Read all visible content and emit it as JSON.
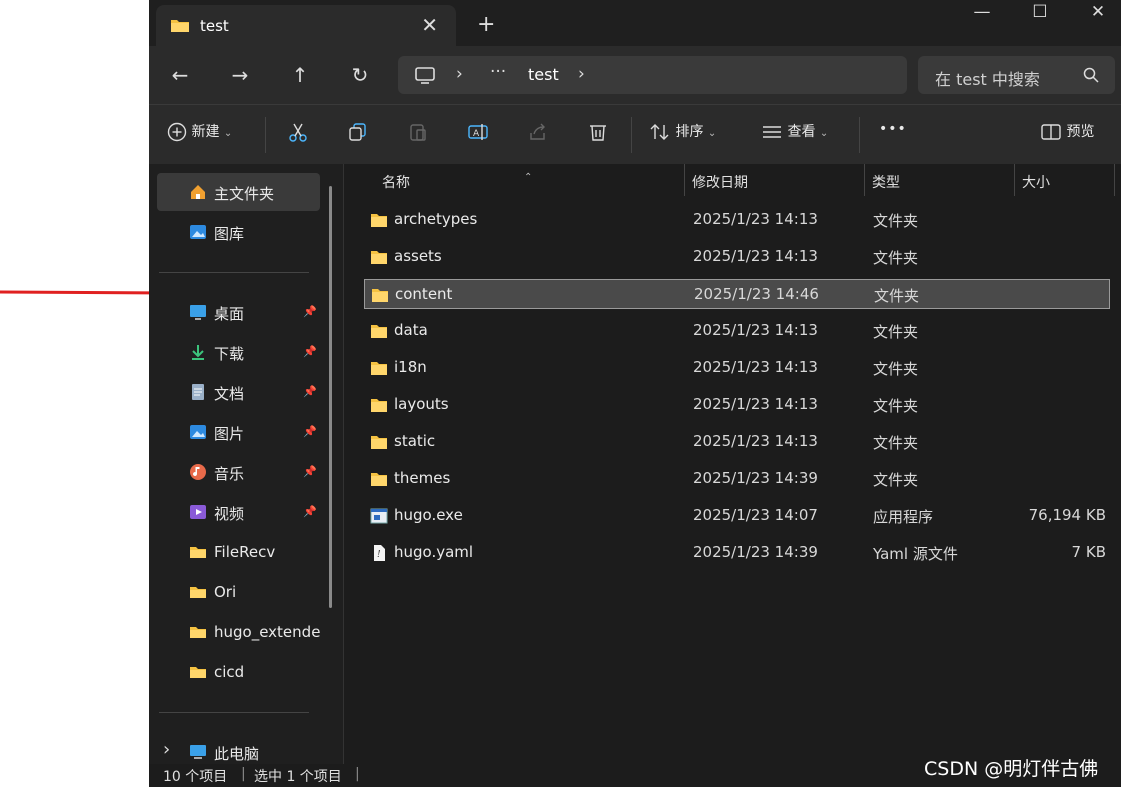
{
  "window": {
    "tab_title": "test",
    "tab_close": "✕",
    "new_tab": "+",
    "controls": {
      "minimize": "—",
      "maximize": "☐",
      "close": "✕"
    }
  },
  "nav": {
    "back": "←",
    "forward": "→",
    "up": "↑",
    "refresh": "↻",
    "breadcrumb_more": "···",
    "breadcrumb_current": "test",
    "search_placeholder": "在 test 中搜索"
  },
  "toolbar": {
    "new_label": "新建",
    "sort_label": "排序",
    "view_label": "查看",
    "more": "•••",
    "preview_label": "预览"
  },
  "sidebar": {
    "items": [
      {
        "label": "主文件夹",
        "icon": "home-icon",
        "pinned": false,
        "active": true
      },
      {
        "label": "图库",
        "icon": "gallery-icon",
        "pinned": false
      },
      {
        "label": "桌面",
        "icon": "desktop-icon",
        "pinned": true
      },
      {
        "label": "下载",
        "icon": "download-icon",
        "pinned": true
      },
      {
        "label": "文档",
        "icon": "document-icon",
        "pinned": true
      },
      {
        "label": "图片",
        "icon": "pictures-icon",
        "pinned": true
      },
      {
        "label": "音乐",
        "icon": "music-icon",
        "pinned": true
      },
      {
        "label": "视频",
        "icon": "video-icon",
        "pinned": true
      },
      {
        "label": "FileRecv",
        "icon": "folder-icon",
        "pinned": false
      },
      {
        "label": "Ori",
        "icon": "folder-icon",
        "pinned": false
      },
      {
        "label": "hugo_extende",
        "icon": "folder-icon",
        "pinned": false
      },
      {
        "label": "cicd",
        "icon": "folder-icon",
        "pinned": false
      }
    ],
    "this_pc": "此电脑",
    "expand": "›"
  },
  "columns": {
    "name": "名称",
    "modified": "修改日期",
    "type": "类型",
    "size": "大小"
  },
  "files": [
    {
      "name": "archetypes",
      "modified": "2025/1/23 14:13",
      "type": "文件夹",
      "size": "",
      "kind": "folder"
    },
    {
      "name": "assets",
      "modified": "2025/1/23 14:13",
      "type": "文件夹",
      "size": "",
      "kind": "folder"
    },
    {
      "name": "content",
      "modified": "2025/1/23 14:46",
      "type": "文件夹",
      "size": "",
      "kind": "folder",
      "selected": true
    },
    {
      "name": "data",
      "modified": "2025/1/23 14:13",
      "type": "文件夹",
      "size": "",
      "kind": "folder"
    },
    {
      "name": "i18n",
      "modified": "2025/1/23 14:13",
      "type": "文件夹",
      "size": "",
      "kind": "folder"
    },
    {
      "name": "layouts",
      "modified": "2025/1/23 14:13",
      "type": "文件夹",
      "size": "",
      "kind": "folder"
    },
    {
      "name": "static",
      "modified": "2025/1/23 14:13",
      "type": "文件夹",
      "size": "",
      "kind": "folder"
    },
    {
      "name": "themes",
      "modified": "2025/1/23 14:39",
      "type": "文件夹",
      "size": "",
      "kind": "folder"
    },
    {
      "name": "hugo.exe",
      "modified": "2025/1/23 14:07",
      "type": "应用程序",
      "size": "76,194 KB",
      "kind": "exe"
    },
    {
      "name": "hugo.yaml",
      "modified": "2025/1/23 14:39",
      "type": "Yaml 源文件",
      "size": "7 KB",
      "kind": "yaml"
    }
  ],
  "status": {
    "count": "10 个项目",
    "selected": "选中 1 个项目",
    "sep": "|"
  },
  "watermark": "CSDN @明灯伴古佛",
  "colors": {
    "folder": "#f5c242",
    "annotation_arrow": "#e02020",
    "accent": "#60cdff"
  }
}
